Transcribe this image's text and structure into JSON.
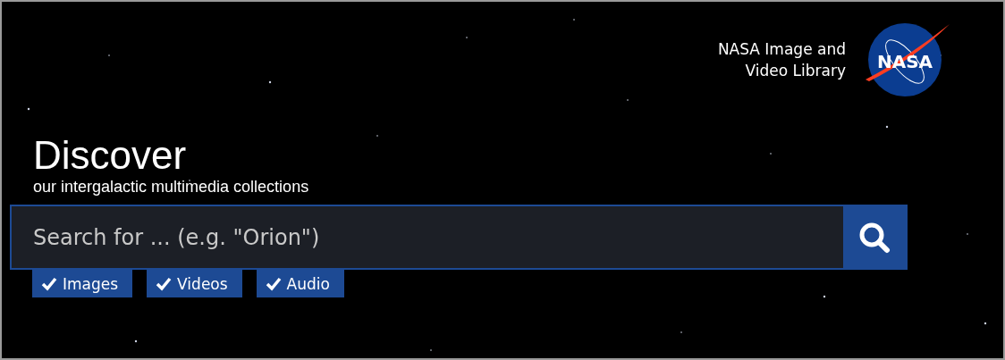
{
  "brand": {
    "title_lines": [
      "NASA Image and",
      "Video Library"
    ],
    "logo_text": "NASA"
  },
  "hero": {
    "title": "Discover",
    "subtitle": "our intergalactic multimedia collections"
  },
  "search": {
    "placeholder": "Search for ... (e.g. \"Orion\")"
  },
  "filters": [
    {
      "label": "Images",
      "checked": true
    },
    {
      "label": "Videos",
      "checked": true
    },
    {
      "label": "Audio",
      "checked": true
    }
  ]
}
